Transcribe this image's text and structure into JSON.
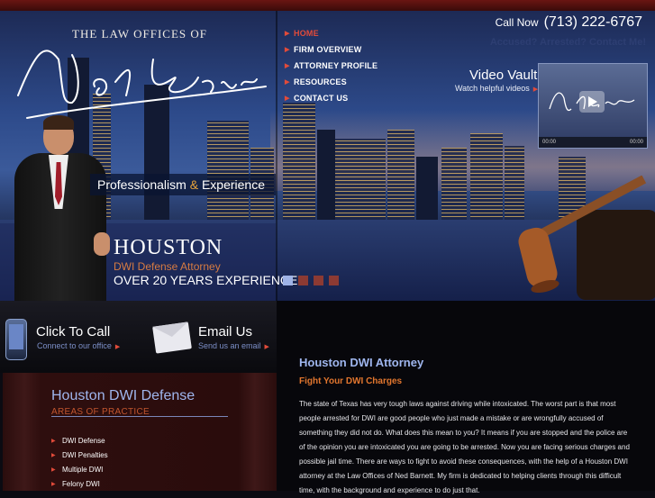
{
  "brand": {
    "law_offices": "THE LAW OFFICES OF",
    "signature": "Ned Barnett",
    "tagline_prefix": "Professionalism",
    "tagline_amp": "&",
    "tagline_suffix": "Experience",
    "city": "HOUSTON",
    "practice": "DWI Defense Attorney",
    "years": "OVER 20 YEARS EXPERIENCE"
  },
  "nav": {
    "items": [
      {
        "label": "HOME",
        "active": true
      },
      {
        "label": "FIRM OVERVIEW",
        "active": false
      },
      {
        "label": "ATTORNEY PROFILE",
        "active": false
      },
      {
        "label": "RESOURCES",
        "active": false
      },
      {
        "label": "CONTACT US",
        "active": false
      }
    ]
  },
  "header": {
    "call_label": "Call Now",
    "phone": "(713) 222-6767",
    "accused": "Accused? Arrested? Contact Me!"
  },
  "video": {
    "title": "Video Vault",
    "subtitle": "Watch helpful videos",
    "time_current": "00:00",
    "time_total": "00:00"
  },
  "slider": {
    "count": 4,
    "active_index": 0
  },
  "contact": {
    "call_title": "Click To Call",
    "call_sub": "Connect to our office",
    "email_title": "Email Us",
    "email_sub": "Send us an email"
  },
  "sidebar": {
    "title": "Houston DWI Defense",
    "subtitle": "AREAS OF PRACTICE",
    "items": [
      "DWI Defense",
      "DWI Penalties",
      "Multiple DWI",
      "Felony DWI"
    ]
  },
  "main": {
    "title": "Houston DWI Attorney",
    "subtitle": "Fight Your DWI Charges",
    "body": "The state of Texas has very tough laws against driving while intoxicated. The worst part is that most people arrested for DWI are good people who just made a mistake or are wrongfully accused of something they did not do. What does this mean to you? It means if you are stopped and the police are of the opinion you are intoxicated you are going to be arrested. Now you are facing serious charges and possible jail time. There are ways to fight to avoid these consequences, with the help of a Houston DWI attorney at the Law Offices of Ned Barnett. My firm is dedicated to helping clients through this difficult time, with the background and experience to do just that."
  },
  "colors": {
    "accent_red": "#e24b3a",
    "accent_orange": "#e2762e",
    "title_blue": "#9fb6ee",
    "link_blue": "#7c8fc8"
  },
  "icons": [
    "phone-icon",
    "envelope-icon",
    "play-icon",
    "gavel-icon"
  ]
}
